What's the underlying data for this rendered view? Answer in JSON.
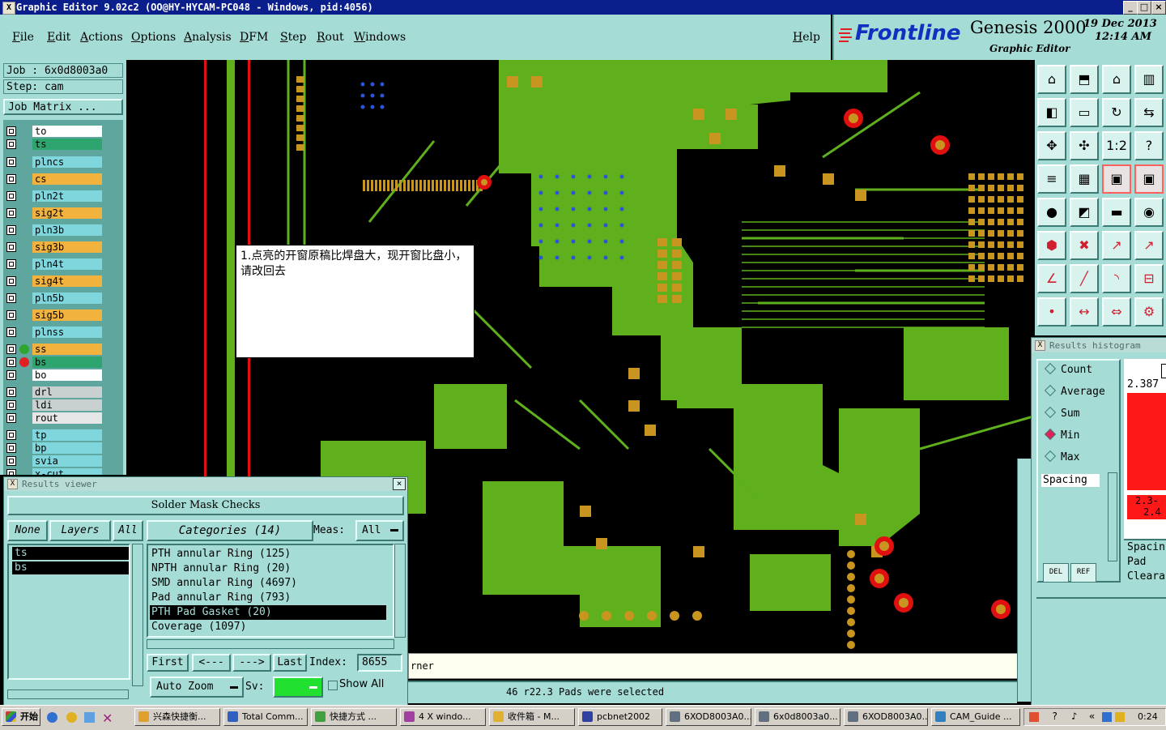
{
  "window": {
    "title": "Graphic Editor 9.02c2 (OO@HY-HYCAM-PC048 - Windows, pid:4056)",
    "min_label": "_",
    "max_label": "□",
    "close_label": "×"
  },
  "menu": {
    "items": [
      "File",
      "Edit",
      "Actions",
      "Options",
      "Analysis",
      "DFM",
      "Step",
      "Rout",
      "Windows"
    ],
    "help": "Help"
  },
  "branding": {
    "logo": "Frontline",
    "product": "Genesis 2000",
    "subtitle": "Graphic Editor",
    "date": "19 Dec 2013",
    "time": "12:14 AM"
  },
  "job": {
    "job_line": "Job : 6x0d8003a0",
    "step_line": "Step: cam",
    "matrix_button": "Job Matrix ..."
  },
  "layers": [
    {
      "name": "to",
      "color": "#ffffff"
    },
    {
      "name": "ts",
      "color": "#2ea56f"
    },
    {
      "name": "plncs",
      "color": "#7fd6dc"
    },
    {
      "name": "cs",
      "color": "#f2b23e"
    },
    {
      "name": "pln2t",
      "color": "#7fd6dc"
    },
    {
      "name": "sig2t",
      "color": "#f2b23e"
    },
    {
      "name": "pln3b",
      "color": "#7fd6dc"
    },
    {
      "name": "sig3b",
      "color": "#f2b23e"
    },
    {
      "name": "pln4t",
      "color": "#7fd6dc"
    },
    {
      "name": "sig4t",
      "color": "#f2b23e"
    },
    {
      "name": "pln5b",
      "color": "#7fd6dc"
    },
    {
      "name": "sig5b",
      "color": "#f2b23e"
    },
    {
      "name": "plnss",
      "color": "#7fd6dc"
    },
    {
      "name": "ss",
      "color": "#f2b23e"
    },
    {
      "name": "bs",
      "color": "#2ea56f"
    },
    {
      "name": "bo",
      "color": "#ffffff"
    },
    {
      "name": "drl",
      "color": "#c8d0d0"
    },
    {
      "name": "ldi",
      "color": "#c8d0d0"
    },
    {
      "name": "rout",
      "color": "#e6e6e6"
    },
    {
      "name": "tp",
      "color": "#7fd6dc"
    },
    {
      "name": "bp",
      "color": "#7fd6dc"
    },
    {
      "name": "svia",
      "color": "#7fd6dc"
    },
    {
      "name": "x-cut",
      "color": "#7fd6dc"
    }
  ],
  "note": {
    "text": "1.点亮的开窗原稿比焊盘大，现开窗比盘小，请改回去"
  },
  "results_viewer": {
    "title": "Results viewer",
    "check_name": "Solder Mask Checks",
    "none_label": "None",
    "layers_label": "Layers",
    "all_label": "All",
    "categories_label": "Categories (14)",
    "meas_label": "Meas:",
    "meas_value": "All",
    "layer_items": [
      "ts",
      "bs"
    ],
    "categories": [
      "PTH annular Ring (125)",
      "NPTH annular Ring (20)",
      "SMD annular Ring (4697)",
      "Pad annular Ring (793)",
      "PTH Pad Gasket (20)",
      "Coverage (1097)"
    ],
    "selected_category": 4,
    "first_label": "First",
    "prev_label": "<---",
    "next_label": "--->",
    "last_label": "Last",
    "index_label": "Index:",
    "index_value": "8655",
    "zoom_label": "Auto Zoom",
    "sv_label": "Sv:",
    "show_all_label": "Show All"
  },
  "messages": {
    "line1": "rner",
    "status": "46 r22.3 Pads were selected"
  },
  "histogram": {
    "title": "Results histogram",
    "options": [
      "Count",
      "Average",
      "Sum",
      "Min",
      "Max"
    ],
    "selected": "Min",
    "measure": "Spacing",
    "top_value": "2.387",
    "range_label_1": "2.3-",
    "range_label_2": "2.4",
    "legend": [
      "Spacin",
      "Pad",
      "Cleara"
    ],
    "del_label": "DEL",
    "ref_label": "REF"
  },
  "taskbar": {
    "start": "开始",
    "items": [
      {
        "label": "兴森快捷衡...",
        "color": "#e0a030"
      },
      {
        "label": "Total Comm...",
        "color": "#3060c0"
      },
      {
        "label": "快捷方式 ...",
        "color": "#40a040"
      },
      {
        "label": "4 X windo...",
        "color": "#a040a0"
      },
      {
        "label": "收件箱 - M...",
        "color": "#e0b030"
      },
      {
        "label": "pcbnet2002",
        "color": "#3040a0"
      },
      {
        "label": "6XOD8003A0...",
        "color": "#607080"
      },
      {
        "label": "6x0d8003a0...",
        "color": "#607080"
      },
      {
        "label": "6XOD8003A0...",
        "color": "#607080"
      },
      {
        "label": "CAM_Guide ...",
        "color": "#3080c0"
      }
    ],
    "clock": "0:24"
  }
}
